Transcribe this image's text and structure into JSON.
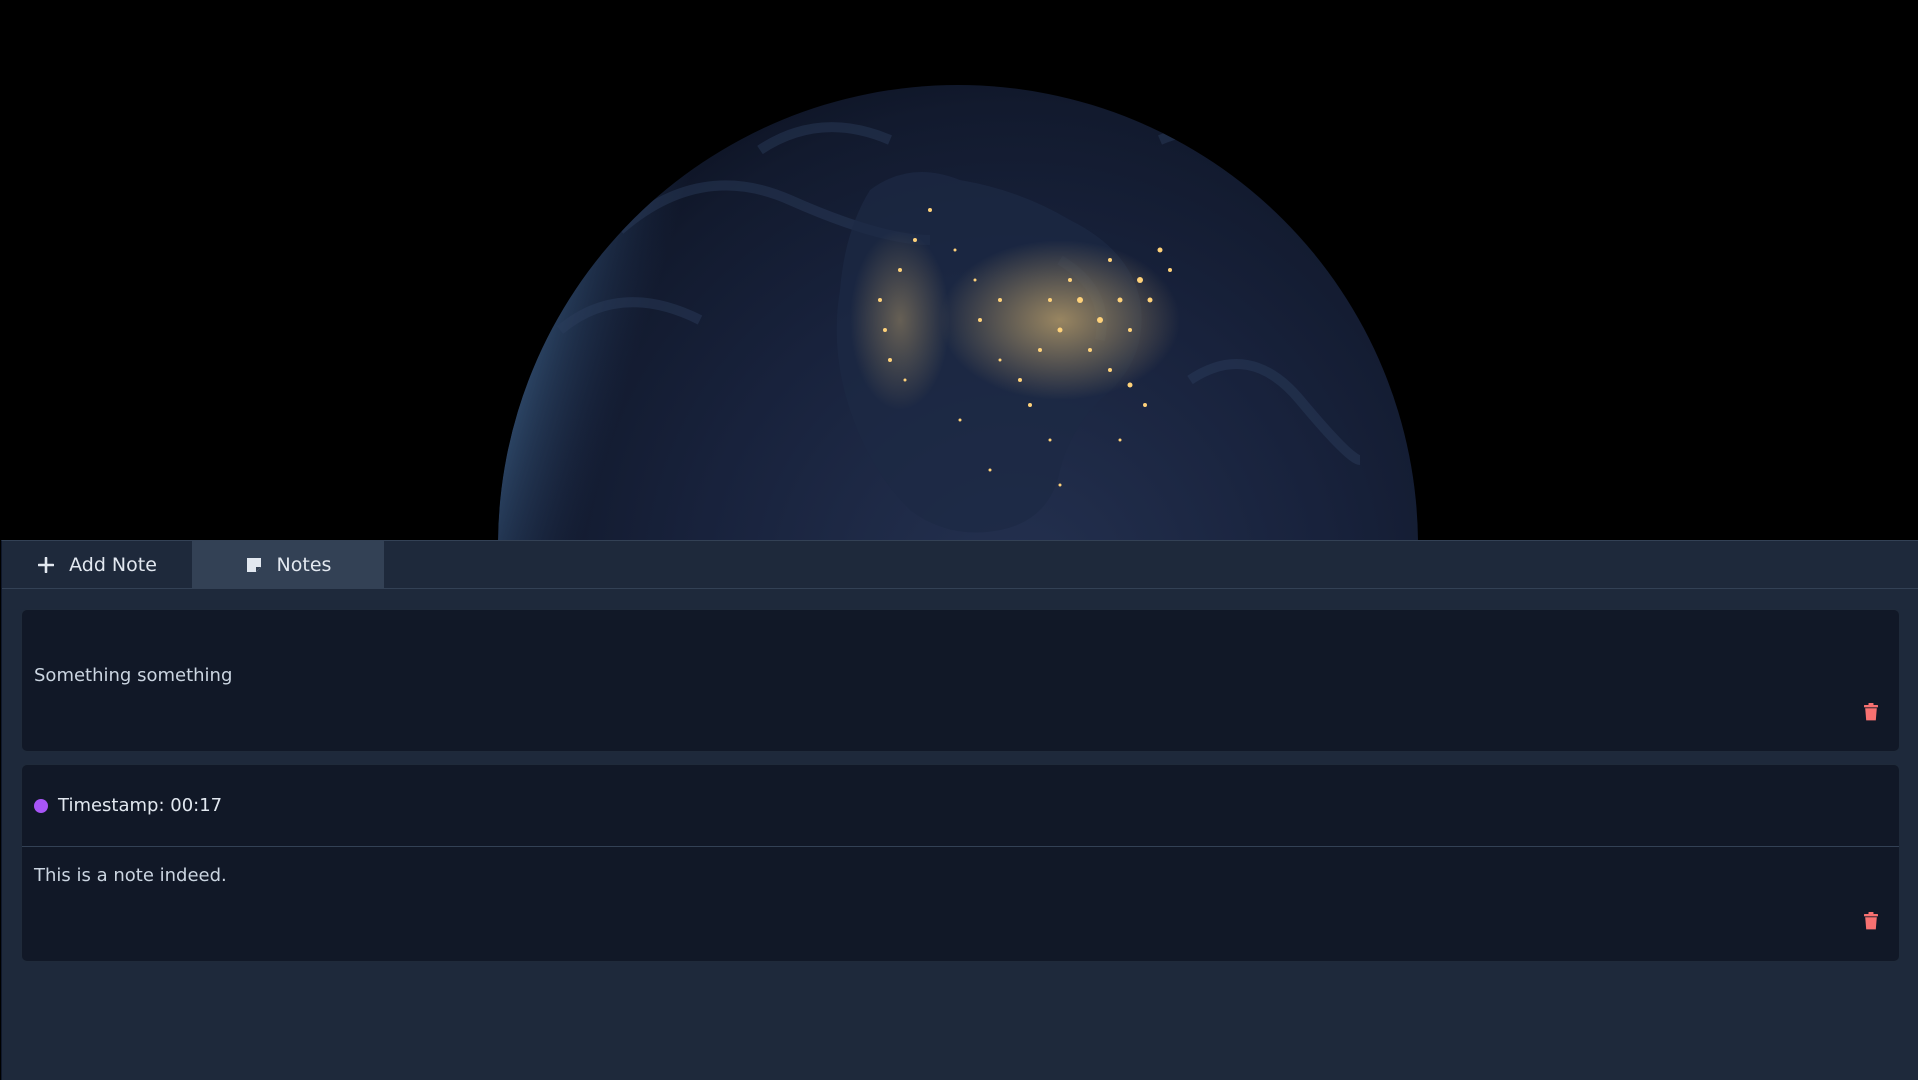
{
  "tabs": [
    {
      "label": "Add Note",
      "icon": "plus-icon",
      "active": false
    },
    {
      "label": "Notes",
      "icon": "sticky-note-icon",
      "active": true
    }
  ],
  "notes": [
    {
      "text": "Something something",
      "delete_icon": "trash-icon"
    },
    {
      "timestamp_label": "Timestamp: 00:17",
      "text": "This is a note indeed.",
      "delete_icon": "trash-icon"
    }
  ],
  "colors": {
    "panel_bg": "#1e293b",
    "card_bg": "#111827",
    "active_tab_bg": "#334155",
    "timestamp_dot": "#a855f7",
    "delete_icon": "#f87171"
  }
}
